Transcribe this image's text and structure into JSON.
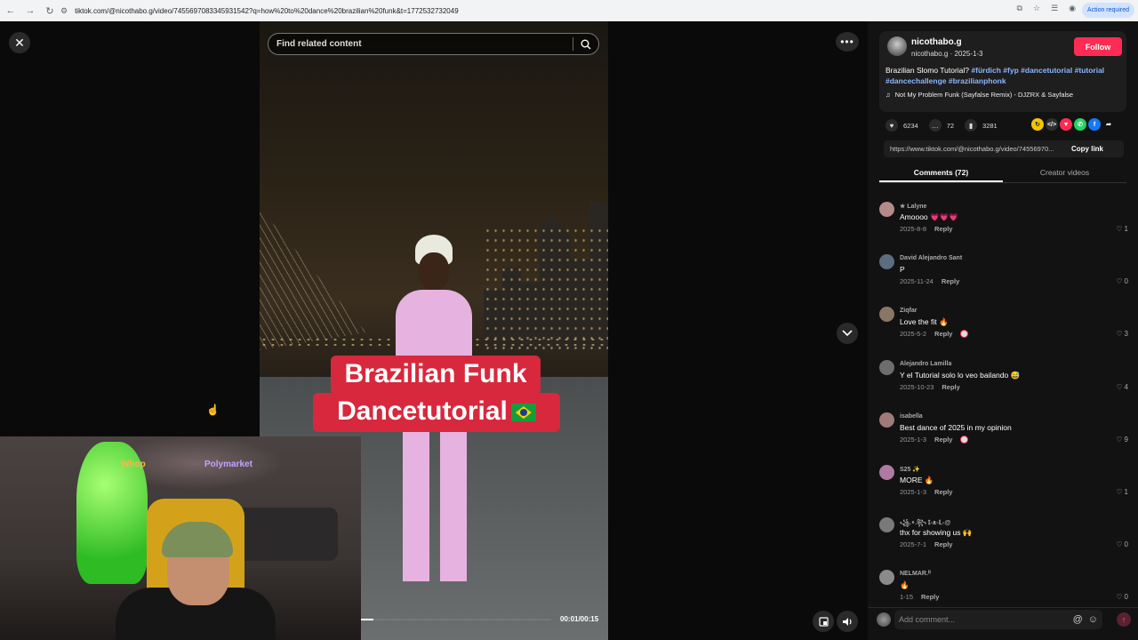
{
  "browser": {
    "url": "tiktok.com/@nicothabo.g/video/7455697083345931542?q=how%20to%20dance%20brazilian%20funk&t=1772532732049",
    "action_required": "Action required"
  },
  "viewer": {
    "search_placeholder": "Find related content",
    "caption_line1": "Brazilian Funk",
    "caption_line2": "Dancetutorial",
    "time_display": "00:01/00:15",
    "progress_fraction": 0.0667,
    "overlay_signs": {
      "whop": "Whop",
      "polymarket": "Polymarket"
    }
  },
  "post": {
    "username": "nicothabo.g",
    "sub": "nicothabo.g · 2025-1-3",
    "follow_label": "Follow",
    "desc_text": "Brazilian Slomo Tutorial? ",
    "hashtags": [
      "#fürdich",
      "#fyp",
      "#dancetutorial",
      "#tutorial",
      "#dancechallenge",
      "#brazilianphonk"
    ],
    "music": "Not My Problem Funk (Sayfalse Remix) - DJZRX & Sayfalse",
    "likes": "6234",
    "comments": "72",
    "saves": "3281",
    "link": "https://www.tiktok.com/@nicothabo.g/video/74556970...",
    "copy_label": "Copy link",
    "share_colors": [
      "#f5c400",
      "#2f2f2f",
      "#fe2c55",
      "#25d366",
      "#1877f2"
    ]
  },
  "tabs": {
    "comments": "Comments (72)",
    "creator": "Creator videos"
  },
  "comments": [
    {
      "user": "★ Lalyne",
      "text": "Amoooo 💗💗💗",
      "date": "2025-8-8",
      "reply": "Reply",
      "likes": "1",
      "creator_liked": false,
      "avatar_color": "#b58a8a"
    },
    {
      "user": "David Alejandro Sant",
      "text": "P",
      "date": "2025-11-24",
      "reply": "Reply",
      "likes": "0",
      "creator_liked": false,
      "avatar_color": "#5c6d80"
    },
    {
      "user": "Ziqfar",
      "text": "Love the fit 🔥",
      "date": "2025-5-2",
      "reply": "Reply",
      "likes": "3",
      "creator_liked": true,
      "avatar_color": "#8a7763"
    },
    {
      "user": "Alejandro Lamilla",
      "text": "Y el Tutorial solo lo veo bailando 😅",
      "date": "2025-10-23",
      "reply": "Reply",
      "likes": "4",
      "creator_liked": false,
      "avatar_color": "#6d6d6d"
    },
    {
      "user": "isabella",
      "text": "Best dance of 2025 in my opinion",
      "date": "2025-1-3",
      "reply": "Reply",
      "likes": "9",
      "creator_liked": true,
      "avatar_color": "#9e7a7a"
    },
    {
      "user": "S25 ✨",
      "text": "MORE 🔥",
      "date": "2025-1-3",
      "reply": "Reply",
      "likes": "1",
      "creator_liked": false,
      "avatar_color": "#b07aa0"
    },
    {
      "user": "꧁.⍣.꧂ 𝕀-ᴥ-𝕃-@",
      "text": "thx for showing us 🙌",
      "date": "2025-7-1",
      "reply": "Reply",
      "likes": "0",
      "creator_liked": false,
      "avatar_color": "#7a7a7a"
    },
    {
      "user": "NELMAR.ᴿ",
      "text": "🔥",
      "date": "1-15",
      "reply": "Reply",
      "likes": "0",
      "creator_liked": false,
      "avatar_color": "#8a8a8a"
    }
  ],
  "add_comment": {
    "placeholder": "Add comment...",
    "mention": "@",
    "emoji": "☺",
    "send": "↑"
  }
}
